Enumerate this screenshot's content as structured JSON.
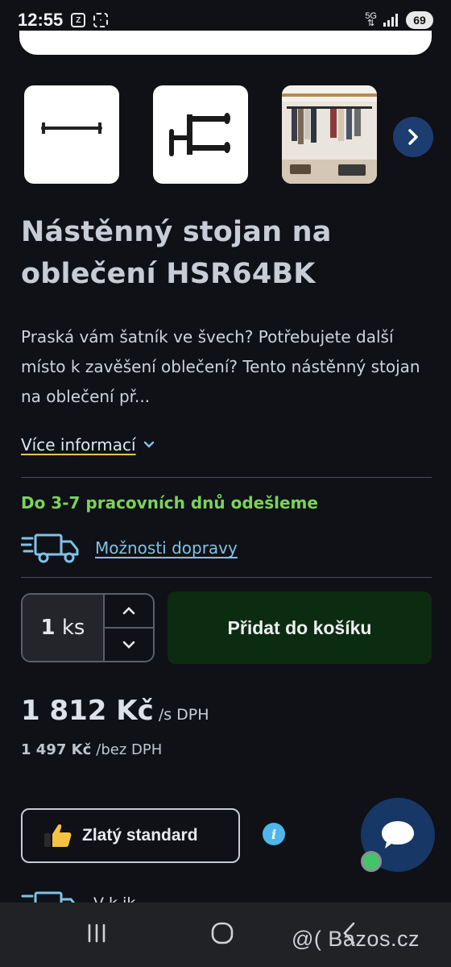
{
  "status_bar": {
    "time": "12:55",
    "network": "5G",
    "battery": "69",
    "icons": [
      "zalo-icon",
      "screenshot-icon",
      "signal-icon"
    ]
  },
  "product": {
    "title": "Nástěnný stojan na oblečení HSR64BK",
    "description": "Praská vám šatník ve švech? Potřebujete další místo k zavěšení oblečení? Tento nástěnný stojan na oblečení př...",
    "more_info_label": "Více informací",
    "shipping_note": "Do 3-7 pracovních dnů odešleme",
    "transport_link": "Možnosti dopravy",
    "quantity": {
      "value": "1",
      "unit": "ks"
    },
    "add_to_cart_label": "Přidat do košíku",
    "price_gross": "1 812 Kč",
    "price_gross_suffix": "/s DPH",
    "price_net": "1 497 Kč",
    "price_net_suffix": "/bez DPH",
    "badge_label": "Zlatý standard",
    "info_symbol": "i",
    "next_peek_text": "V k ik"
  },
  "colors": {
    "background": "#0f1116",
    "cart_button": "#0b2c10",
    "shipping_green": "#7bd35a",
    "link_blue": "#7fc2e8",
    "chat_bubble": "#173766"
  },
  "watermark": "@( Bazos.cz"
}
